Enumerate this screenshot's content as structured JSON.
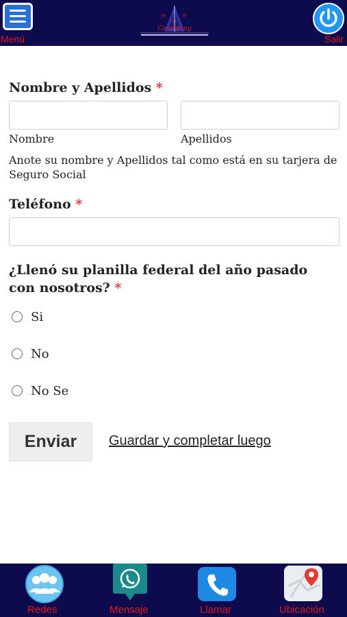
{
  "header": {
    "menu_label": "Menú",
    "logo_letters": [
      "H",
      "D",
      "P"
    ],
    "logo_name": "Consulting",
    "exit_label": "Salir",
    "icons": {
      "menu": "hamburger-icon",
      "exit": "power-icon"
    }
  },
  "form": {
    "name_section": {
      "label": "Nombre y Apellidos",
      "required_mark": "*",
      "first_name_sublabel": "Nombre",
      "last_name_sublabel": "Apellidos",
      "first_name_value": "",
      "last_name_value": "",
      "hint": "Anote su nombre y Apellidos tal como está en su tarjera de Seguro Social"
    },
    "phone_section": {
      "label": "Teléfono",
      "required_mark": "*",
      "value": ""
    },
    "question_section": {
      "label": "¿Llenó su planilla federal del año pasado con nosotros?",
      "required_mark": "*",
      "options": [
        "Si",
        "No",
        "No Se"
      ],
      "selected": null
    },
    "submit_label": "Enviar",
    "save_link_label": "Guardar y completar luego"
  },
  "bottom_nav": {
    "items": [
      {
        "label": "Redes",
        "icon": "people-icon"
      },
      {
        "label": "Mensaje",
        "icon": "whatsapp-icon"
      },
      {
        "label": "Llamar",
        "icon": "phone-icon"
      },
      {
        "label": "Ubicación",
        "icon": "map-pin-icon"
      }
    ]
  },
  "colors": {
    "bar_background": "#0d0a4e",
    "label_red": "#e11919",
    "accent_blue": "#2196f3",
    "whatsapp_teal": "#1b8a8a",
    "required_red": "#dd3333"
  }
}
